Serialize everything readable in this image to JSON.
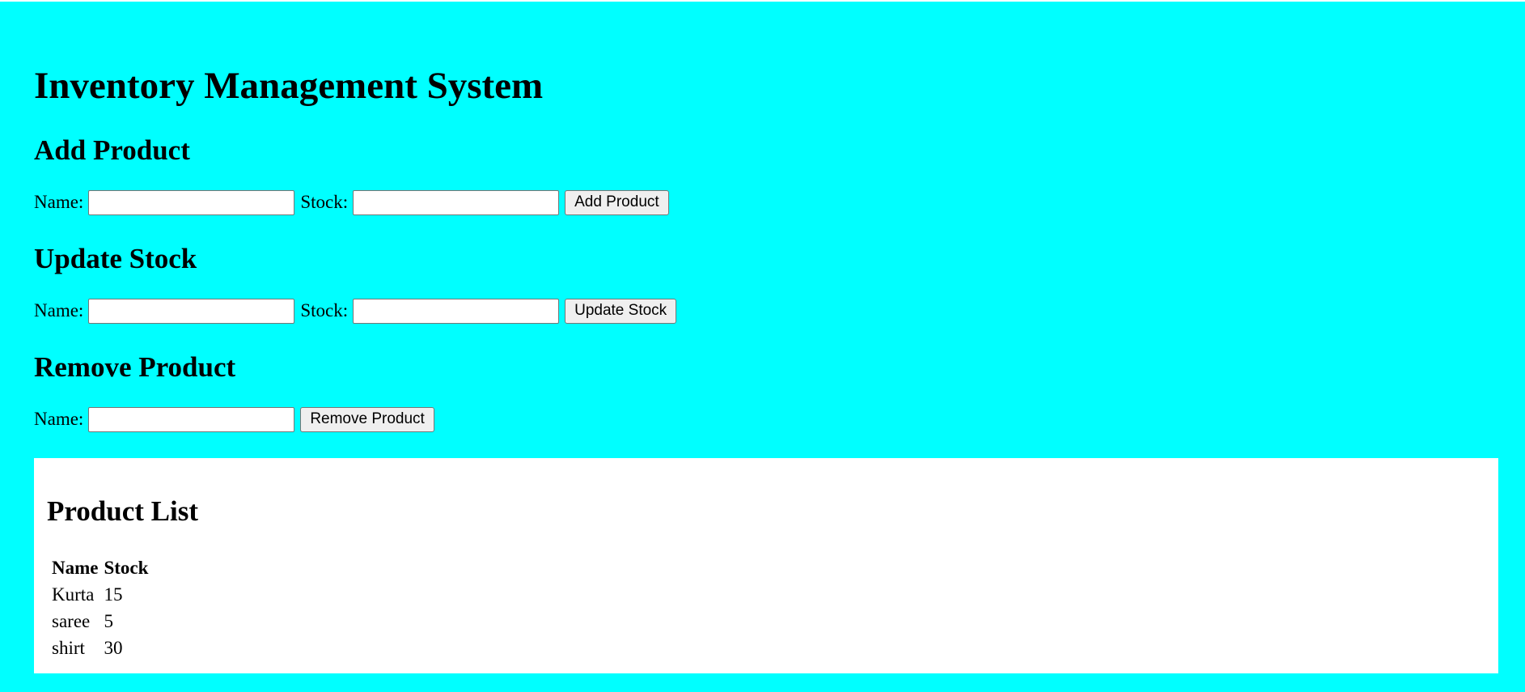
{
  "page": {
    "title": "Inventory Management System",
    "background": "#00ffff",
    "panel_background": "#ffffff"
  },
  "add_product": {
    "heading": "Add Product",
    "name_label": "Name:",
    "name_value": "",
    "stock_label": "Stock:",
    "stock_value": "",
    "button_label": "Add Product"
  },
  "update_stock": {
    "heading": "Update Stock",
    "name_label": "Name:",
    "name_value": "",
    "stock_label": "Stock:",
    "stock_value": "",
    "button_label": "Update Stock"
  },
  "remove_product": {
    "heading": "Remove Product",
    "name_label": "Name:",
    "name_value": "",
    "button_label": "Remove Product"
  },
  "product_list": {
    "heading": "Product List",
    "columns": [
      "Name",
      "Stock"
    ],
    "rows": [
      {
        "name": "Kurta",
        "stock": "15"
      },
      {
        "name": "saree",
        "stock": "5"
      },
      {
        "name": "shirt",
        "stock": "30"
      }
    ]
  }
}
